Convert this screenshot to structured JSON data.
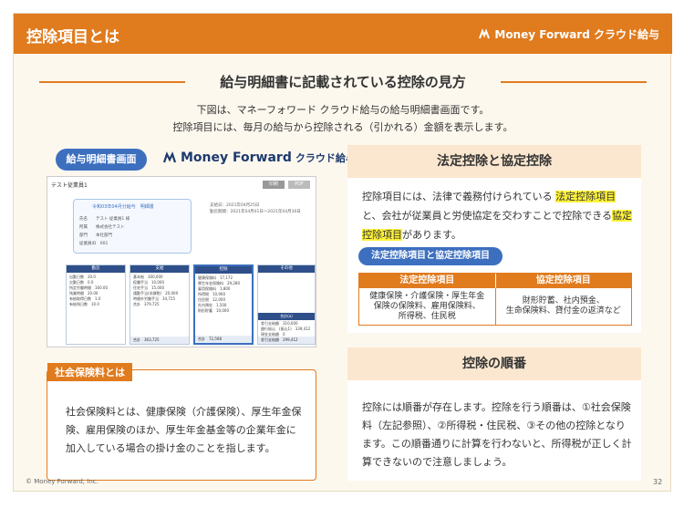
{
  "header": {
    "title": "控除項目とは",
    "brand": "Money Forward クラウド給与"
  },
  "section": {
    "title": "給与明細書に記載されている控除の見方"
  },
  "intro": {
    "line1": "下図は、マネーフォワード クラウド給与の給与明細書画面です。",
    "line2": "控除項目には、毎月の給与から控除される（引かれる）金額を表示します。"
  },
  "left": {
    "pill": "給与明細書画面",
    "logo_main": "Money Forward",
    "logo_sub": "クラウド給与",
    "slip": {
      "title": "テスト従業員1",
      "btn_a": "印刷",
      "btn_b": "PDF",
      "card_title": "令和03年04月分給与　明細書",
      "card_rows": [
        "氏名　　テスト 従業員1 様",
        "所属　　株式会社テスト",
        "部門　　本社部門",
        "従業員ID　001"
      ],
      "meta": [
        "支給日：2021年04月25日",
        "勤怠期間：2021年04月01日〜2021年04月30日"
      ],
      "tables": [
        {
          "head": "勤怠",
          "rows": [
            "出勤日数　20.0",
            "欠勤日数　0.0",
            "所定労働時間　160.00",
            "残業時間　20.00",
            "有給取得日数　1.0",
            "有給残日数　10.0"
          ],
          "total": ""
        },
        {
          "head": "支給",
          "rows": [
            "基本給　300,000",
            "役職手当　10,000",
            "住宅手当　15,000",
            "通勤手当(非課税)　20,000",
            "時間外労働手当　34,725",
            "合計　379,725"
          ],
          "total": "合計　363,725"
        },
        {
          "head": "控除",
          "rows": [
            "健康保険料　17,172",
            "厚生年金保険料　29,280",
            "雇用保険料　1,800",
            "所得税　10,900",
            "住民税　12,000",
            "社内預金　1,500",
            "財形貯蓄　10,000"
          ],
          "total": "合計　72,598"
        },
        {
          "head": "その他",
          "rows": [],
          "sub": "合計(a)",
          "subrows": [
            "差引支給額　310,000",
            "銀行振込　(振込1)　339,412",
            "現金支給額　0"
          ],
          "total": "差引支給額　299,412"
        }
      ]
    },
    "ss": {
      "tag": "社会保険料とは",
      "text": "社会保険料とは、健康保険（介護保険）、厚生年金保険、雇用保険のほか、厚生年金基金等の企業年金に加入している場合の掛け金のことを指します。"
    }
  },
  "right": {
    "panel1": {
      "title": "法定控除と協定控除",
      "text_a": "控除項目には、法律で義務付けられている",
      "hl_a": "法定控除項目",
      "text_b": "と、会社が従業員と労使協定を交わすことで控除できる",
      "hl_b": "協定控除項目",
      "text_c": "があります。",
      "pill": "法定控除項目と協定控除項目",
      "col1_head": "法定控除項目",
      "col2_head": "協定控除項目",
      "col1_line1": "健康保険・介護保険・厚生年金",
      "col1_line2": "保険の保険料、雇用保険料、",
      "col1_line3": "所得税、住民税",
      "col2_line1": "財形貯蓄、社内預金、",
      "col2_line2": "生命保険料、貸付金の返済など"
    },
    "panel2": {
      "title": "控除の順番",
      "text": "控除には順番が存在します。控除を行う順番は、①社会保険料（左記参照）、②所得税・住民税、③その他の控除となります。この順番通りに計算を行わないと、所得税が正しく計算できないので注意しましょう。"
    }
  },
  "footer": {
    "copyright": "© Money Forward, Inc.",
    "page": "32"
  },
  "colors": {
    "accent": "#e07b1e",
    "blue": "#3d6fbf",
    "highlight": "#fff33a"
  }
}
